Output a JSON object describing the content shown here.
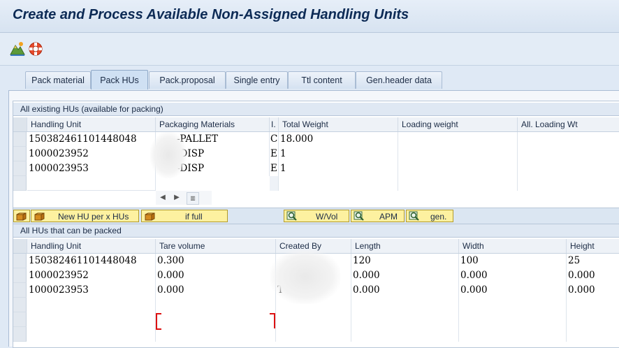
{
  "window": {
    "title": "Create and Process Available Non-Assigned Handling Units"
  },
  "toolbar": {
    "icons": [
      "mountain-chart-icon",
      "lifebuoy-icon"
    ]
  },
  "tabs": [
    {
      "label": "Pack material",
      "active": false
    },
    {
      "label": "Pack HUs",
      "active": true
    },
    {
      "label": "Pack.proposal",
      "active": false
    },
    {
      "label": "Single entry",
      "active": false
    },
    {
      "label": "Ttl content",
      "active": false
    },
    {
      "label": "Gen.header data",
      "active": false
    }
  ],
  "grid1": {
    "title": "All existing HUs (available for packing)",
    "columns": [
      "Handling Unit",
      "Packaging Materials",
      "I.",
      "Total Weight",
      "Loading weight",
      "All. Loading Wt"
    ],
    "rows": [
      {
        "hu": "150382461101448048",
        "pm": "-PALLET",
        "i": "C",
        "tw": "18.000",
        "lw": "",
        "alw": ""
      },
      {
        "hu": "1000023952",
        "pm": "-DISP",
        "i": "E",
        "tw": "1",
        "lw": "",
        "alw": ""
      },
      {
        "hu": "1000023953",
        "pm": "-DISP",
        "i": "E",
        "tw": "1",
        "lw": "",
        "alw": ""
      }
    ]
  },
  "buttons": {
    "new_hu": "New HU per x HUs",
    "if_full": "if full",
    "wvol": "W/Vol",
    "apm": "APM",
    "gen": "gen."
  },
  "grid2": {
    "title": "All HUs that can be packed",
    "columns": [
      "Handling Unit",
      "Tare volume",
      "Created By",
      "Length",
      "Width",
      "Height"
    ],
    "rows": [
      {
        "hu": "150382461101448048",
        "tv": "0.300",
        "cb": "",
        "len": "120",
        "wid": "100",
        "hgt": "25"
      },
      {
        "hu": "1000023952",
        "tv": "0.000",
        "cb": "",
        "len": "0.000",
        "wid": "0.000",
        "hgt": "0.000"
      },
      {
        "hu": "1000023953",
        "tv": "0.000",
        "cb": "T",
        "len": "0.000",
        "wid": "0.000",
        "hgt": "0.000"
      }
    ]
  }
}
